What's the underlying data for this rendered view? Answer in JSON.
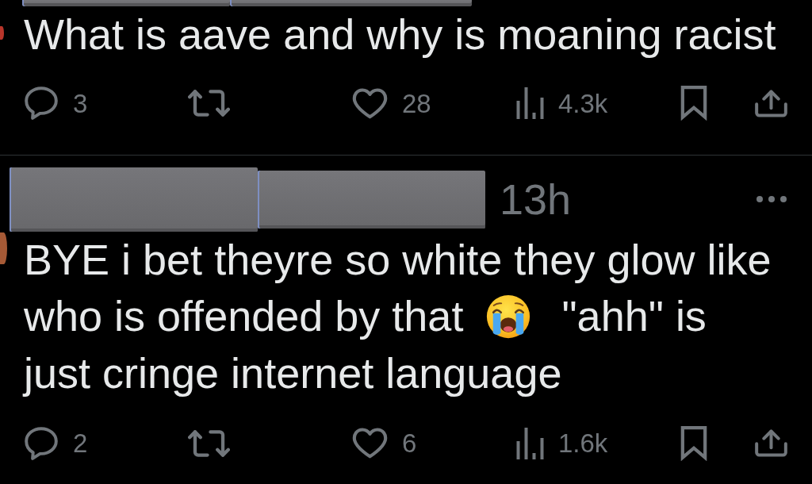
{
  "posts": [
    {
      "body": [
        {
          "kind": "text",
          "text": "What is aave and why is moaning racist"
        }
      ],
      "actions": [
        {
          "kind": "reply",
          "count": "3"
        },
        {
          "kind": "repost",
          "on": false
        },
        {
          "kind": "like",
          "count": "28",
          "on": false
        },
        {
          "kind": "views",
          "count": "4.3k"
        },
        {
          "kind": "bookmark",
          "on": false
        },
        {
          "kind": "share"
        }
      ]
    },
    {
      "time": "13h",
      "body": [
        {
          "kind": "text",
          "text": "BYE i bet theyre so white they glow like who is offended by that"
        },
        {
          "kind": "emoji"
        },
        {
          "kind": "text",
          "text": "\"ahh\" is just cringe internet language"
        }
      ],
      "actions": [
        {
          "kind": "reply",
          "count": "2"
        },
        {
          "kind": "repost",
          "on": false
        },
        {
          "kind": "like",
          "count": "6",
          "on": false
        },
        {
          "kind": "views",
          "count": "1.6k"
        },
        {
          "kind": "bookmark",
          "on": false
        },
        {
          "kind": "share"
        }
      ]
    }
  ]
}
